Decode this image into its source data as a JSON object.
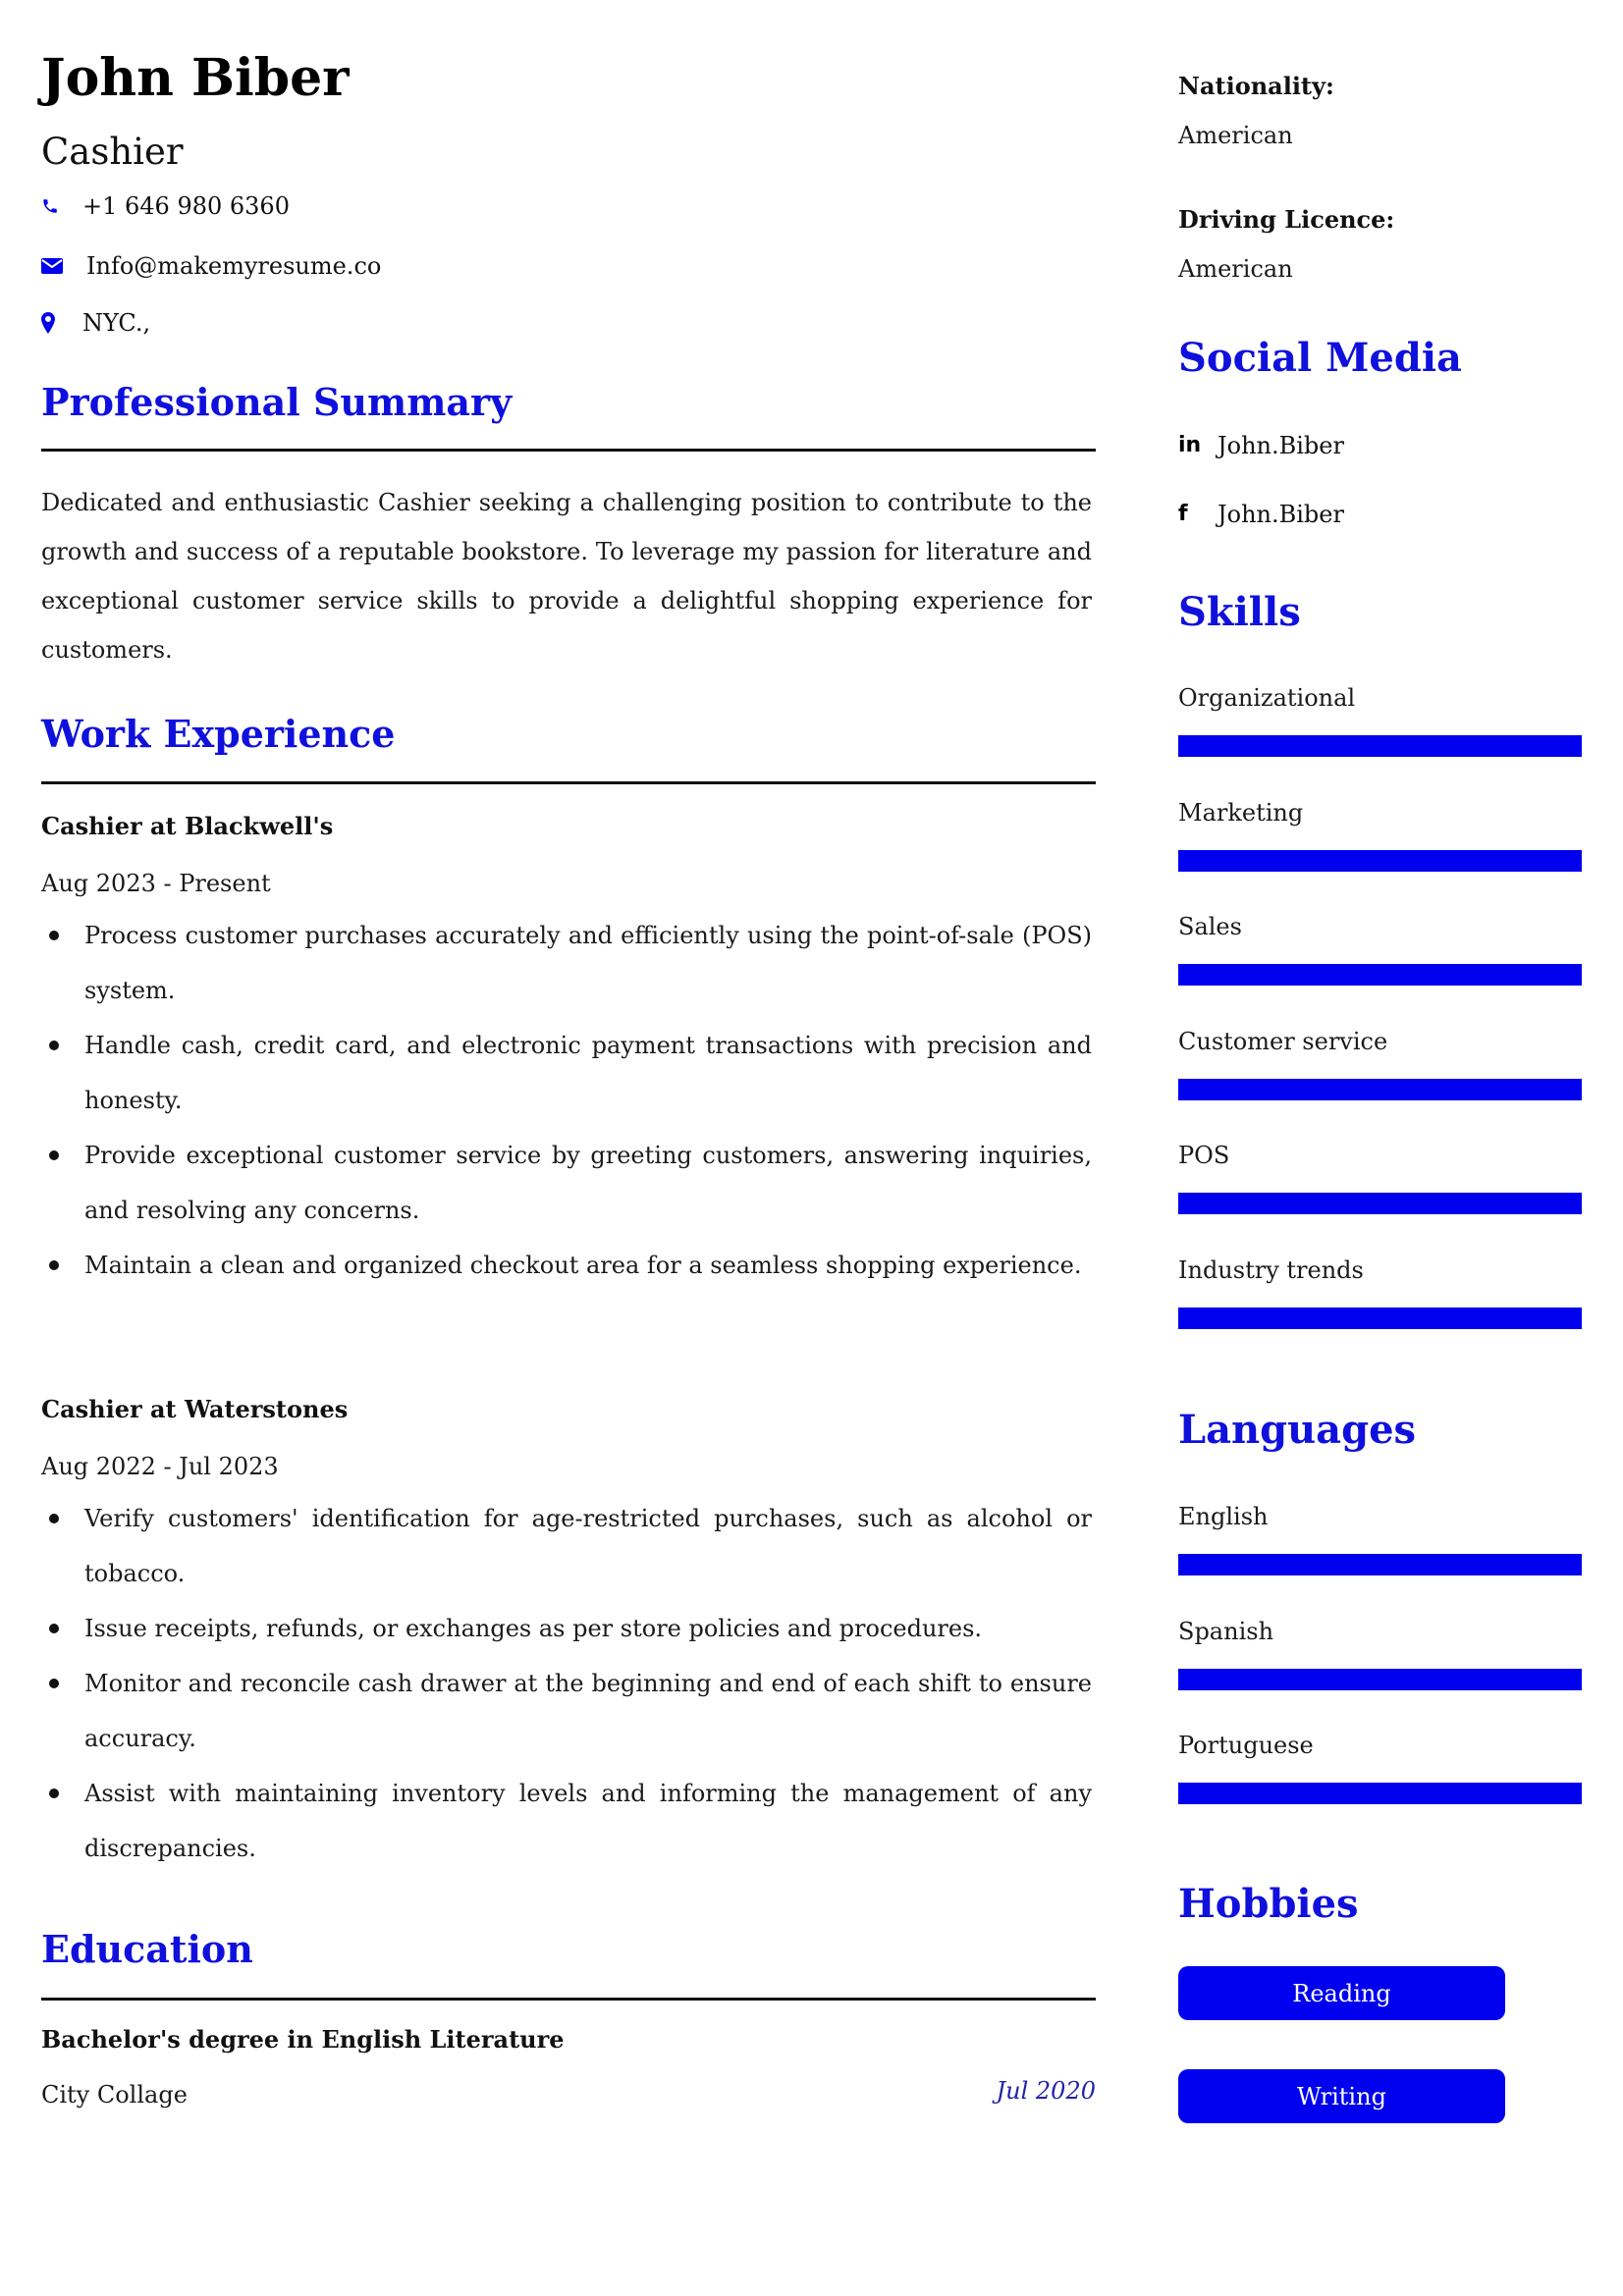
{
  "header": {
    "name": "John Biber",
    "job_title": "Cashier",
    "contacts": [
      {
        "icon": "phone-icon",
        "text": "+1 646 980 6360"
      },
      {
        "icon": "envelope-icon",
        "text": "Info@makemyresume.co"
      },
      {
        "icon": "map-marker-icon",
        "text": "NYC.,"
      }
    ]
  },
  "summary": {
    "heading": "Professional Summary",
    "text": "Dedicated and enthusiastic Cashier seeking a challenging position to contribute to the growth and success of a reputable bookstore. To leverage my passion for literature and exceptional customer service skills to provide a delightful shopping experience for customers."
  },
  "experience": {
    "heading": "Work Experience",
    "jobs": [
      {
        "title": "Cashier at Blackwell's",
        "dates": "Aug 2023 - Present",
        "bullets": [
          "Process customer purchases accurately and efficiently using the point-of-sale (POS) system.",
          "Handle cash, credit card, and electronic payment transactions with precision and honesty.",
          "Provide exceptional customer service by greeting customers, answering inquiries, and resolving any concerns.",
          "Maintain a clean and organized checkout area for a seamless shopping experience."
        ]
      },
      {
        "title": "Cashier at Waterstones",
        "dates": "Aug 2022 - Jul 2023",
        "bullets": [
          "Verify customers' identification for age-restricted purchases, such as alcohol or tobacco.",
          "Issue receipts, refunds, or exchanges as per store policies and procedures.",
          "Monitor and reconcile cash drawer at the beginning and end of each shift to ensure accuracy.",
          "Assist with maintaining inventory levels and informing the management of any discrepancies."
        ]
      }
    ]
  },
  "education": {
    "heading": "Education",
    "degree": "Bachelor's degree in English Literature",
    "school": "City Collage",
    "date": "Jul 2020"
  },
  "sidebar": {
    "details": [
      {
        "label": "Nationality:",
        "value": "American"
      },
      {
        "label": "Driving Licence:",
        "value": "American"
      }
    ],
    "social": {
      "heading": "Social Media",
      "items": [
        {
          "icon": "linkedin-icon",
          "text": "John.Biber"
        },
        {
          "icon": "facebook-icon",
          "text": "John.Biber"
        }
      ]
    },
    "skills": {
      "heading": "Skills",
      "items": [
        {
          "name": "Organizational",
          "level": 1.0
        },
        {
          "name": "Marketing",
          "level": 1.0
        },
        {
          "name": "Sales",
          "level": 1.0
        },
        {
          "name": "Customer service",
          "level": 1.0
        },
        {
          "name": "POS",
          "level": 1.0
        },
        {
          "name": "Industry trends",
          "level": 1.0
        }
      ]
    },
    "languages": {
      "heading": "Languages",
      "items": [
        {
          "name": "English",
          "level": 1.0
        },
        {
          "name": "Spanish",
          "level": 1.0
        },
        {
          "name": "Portuguese",
          "level": 1.0
        }
      ]
    },
    "hobbies": {
      "heading": "Hobbies",
      "items": [
        "Reading",
        "Writing"
      ]
    }
  },
  "colors": {
    "accent": "#0000ee",
    "heading": "#1010dd",
    "date_accent": "#2222aa"
  }
}
